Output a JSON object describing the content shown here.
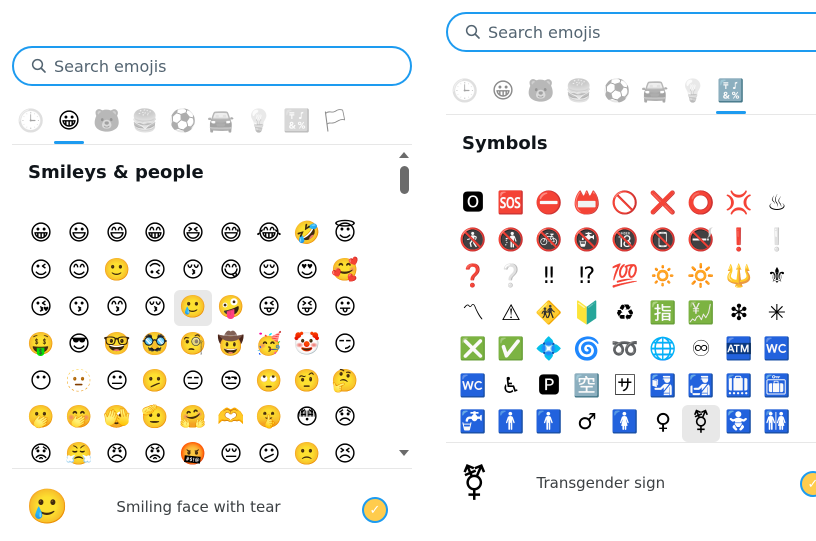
{
  "left": {
    "search": {
      "placeholder": "Search emojis"
    },
    "tabs": [
      {
        "name": "recent",
        "glyph": "🕒",
        "active": false
      },
      {
        "name": "smileys",
        "glyph": "😀",
        "active": true
      },
      {
        "name": "animals",
        "glyph": "🐻",
        "active": false
      },
      {
        "name": "food",
        "glyph": "🍔",
        "active": false
      },
      {
        "name": "activities",
        "glyph": "⚽",
        "active": false
      },
      {
        "name": "travel",
        "glyph": "🚘",
        "active": false
      },
      {
        "name": "objects",
        "glyph": "💡",
        "active": false
      },
      {
        "name": "symbols",
        "glyph": "🔣",
        "active": false
      },
      {
        "name": "flags",
        "glyph": "🏳",
        "active": false
      }
    ],
    "section_title": "Smileys & people",
    "emojis": [
      "😀",
      "😃",
      "😄",
      "😁",
      "😆",
      "😅",
      "😂",
      "🤣",
      "😇",
      "😉",
      "😊",
      "🙂",
      "🙃",
      "😚",
      "😋",
      "😌",
      "😍",
      "🥰",
      "😘",
      "😗",
      "😙",
      "😚",
      "🥲",
      "🤪",
      "😜",
      "😝",
      "😛",
      "🤑",
      "😎",
      "🤓",
      "🥸",
      "🧐",
      "🤠",
      "🥳",
      "🤡",
      "😏",
      "😶",
      "🫥",
      "😐",
      "🫤",
      "😑",
      "😒",
      "🙄",
      "🤨",
      "🤔",
      "🫢",
      "🤭",
      "🫣",
      "🫡",
      "🤗",
      "🫶",
      "🤫",
      "😳",
      "😞",
      "😟",
      "😤",
      "😠",
      "😡",
      "🤬",
      "😔",
      "😕",
      "🙁",
      "😣"
    ],
    "selected_index": 22,
    "footer": {
      "preview": "🥲",
      "name": "Smiling face with tear"
    }
  },
  "right": {
    "search": {
      "placeholder": "Search emojis"
    },
    "tabs": [
      {
        "name": "recent",
        "glyph": "🕒",
        "active": false
      },
      {
        "name": "smileys",
        "glyph": "😀",
        "active": false
      },
      {
        "name": "animals",
        "glyph": "🐻",
        "active": false
      },
      {
        "name": "food",
        "glyph": "🍔",
        "active": false
      },
      {
        "name": "activities",
        "glyph": "⚽",
        "active": false
      },
      {
        "name": "travel",
        "glyph": "🚘",
        "active": false
      },
      {
        "name": "objects",
        "glyph": "💡",
        "active": false
      },
      {
        "name": "symbols",
        "glyph": "🔣",
        "active": true
      }
    ],
    "section_title": "Symbols",
    "emojis": [
      "🅾",
      "🆘",
      "⛔",
      "📛",
      "🚫",
      "❌",
      "⭕",
      "💢",
      "♨",
      "🚷",
      "🚯",
      "🚳",
      "🚱",
      "🔞",
      "📵",
      "🚭",
      "❗",
      "❕",
      "❓",
      "❔",
      "‼",
      "⁉",
      "💯",
      "🔅",
      "🔆",
      "🔱",
      "⚜",
      "〽",
      "⚠",
      "🚸",
      "🔰",
      "♻",
      "🈯",
      "💹",
      "❇",
      "✳",
      "❎",
      "✅",
      "💠",
      "🌀",
      "➿",
      "🌐",
      "♾",
      "🏧",
      "🚾",
      "🚾",
      "♿",
      "🅿",
      "🈳",
      "🈂",
      "🛂",
      "🛃",
      "🛄",
      "🛅",
      "🚰",
      "🚹",
      "🚹",
      "♂",
      "🚺",
      "♀",
      "⚧",
      "🚼",
      "🚻"
    ],
    "selected_index": 60,
    "footer": {
      "preview": "⚧",
      "name": "Transgender sign"
    }
  }
}
